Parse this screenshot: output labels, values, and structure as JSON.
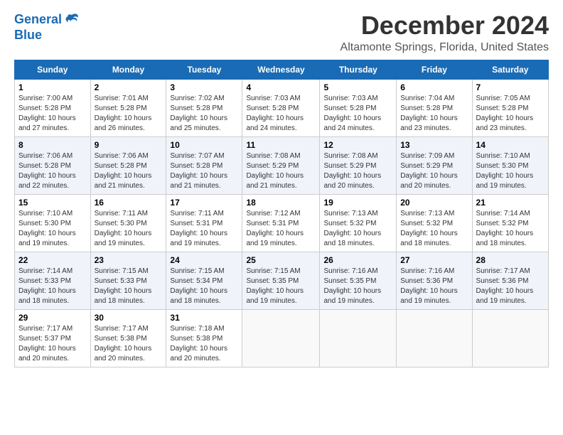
{
  "logo": {
    "line1": "General",
    "line2": "Blue"
  },
  "title": "December 2024",
  "subtitle": "Altamonte Springs, Florida, United States",
  "days_of_week": [
    "Sunday",
    "Monday",
    "Tuesday",
    "Wednesday",
    "Thursday",
    "Friday",
    "Saturday"
  ],
  "weeks": [
    [
      {
        "day": 1,
        "info": "Sunrise: 7:00 AM\nSunset: 5:28 PM\nDaylight: 10 hours\nand 27 minutes."
      },
      {
        "day": 2,
        "info": "Sunrise: 7:01 AM\nSunset: 5:28 PM\nDaylight: 10 hours\nand 26 minutes."
      },
      {
        "day": 3,
        "info": "Sunrise: 7:02 AM\nSunset: 5:28 PM\nDaylight: 10 hours\nand 25 minutes."
      },
      {
        "day": 4,
        "info": "Sunrise: 7:03 AM\nSunset: 5:28 PM\nDaylight: 10 hours\nand 24 minutes."
      },
      {
        "day": 5,
        "info": "Sunrise: 7:03 AM\nSunset: 5:28 PM\nDaylight: 10 hours\nand 24 minutes."
      },
      {
        "day": 6,
        "info": "Sunrise: 7:04 AM\nSunset: 5:28 PM\nDaylight: 10 hours\nand 23 minutes."
      },
      {
        "day": 7,
        "info": "Sunrise: 7:05 AM\nSunset: 5:28 PM\nDaylight: 10 hours\nand 23 minutes."
      }
    ],
    [
      {
        "day": 8,
        "info": "Sunrise: 7:06 AM\nSunset: 5:28 PM\nDaylight: 10 hours\nand 22 minutes."
      },
      {
        "day": 9,
        "info": "Sunrise: 7:06 AM\nSunset: 5:28 PM\nDaylight: 10 hours\nand 21 minutes."
      },
      {
        "day": 10,
        "info": "Sunrise: 7:07 AM\nSunset: 5:28 PM\nDaylight: 10 hours\nand 21 minutes."
      },
      {
        "day": 11,
        "info": "Sunrise: 7:08 AM\nSunset: 5:29 PM\nDaylight: 10 hours\nand 21 minutes."
      },
      {
        "day": 12,
        "info": "Sunrise: 7:08 AM\nSunset: 5:29 PM\nDaylight: 10 hours\nand 20 minutes."
      },
      {
        "day": 13,
        "info": "Sunrise: 7:09 AM\nSunset: 5:29 PM\nDaylight: 10 hours\nand 20 minutes."
      },
      {
        "day": 14,
        "info": "Sunrise: 7:10 AM\nSunset: 5:30 PM\nDaylight: 10 hours\nand 19 minutes."
      }
    ],
    [
      {
        "day": 15,
        "info": "Sunrise: 7:10 AM\nSunset: 5:30 PM\nDaylight: 10 hours\nand 19 minutes."
      },
      {
        "day": 16,
        "info": "Sunrise: 7:11 AM\nSunset: 5:30 PM\nDaylight: 10 hours\nand 19 minutes."
      },
      {
        "day": 17,
        "info": "Sunrise: 7:11 AM\nSunset: 5:31 PM\nDaylight: 10 hours\nand 19 minutes."
      },
      {
        "day": 18,
        "info": "Sunrise: 7:12 AM\nSunset: 5:31 PM\nDaylight: 10 hours\nand 19 minutes."
      },
      {
        "day": 19,
        "info": "Sunrise: 7:13 AM\nSunset: 5:32 PM\nDaylight: 10 hours\nand 18 minutes."
      },
      {
        "day": 20,
        "info": "Sunrise: 7:13 AM\nSunset: 5:32 PM\nDaylight: 10 hours\nand 18 minutes."
      },
      {
        "day": 21,
        "info": "Sunrise: 7:14 AM\nSunset: 5:32 PM\nDaylight: 10 hours\nand 18 minutes."
      }
    ],
    [
      {
        "day": 22,
        "info": "Sunrise: 7:14 AM\nSunset: 5:33 PM\nDaylight: 10 hours\nand 18 minutes."
      },
      {
        "day": 23,
        "info": "Sunrise: 7:15 AM\nSunset: 5:33 PM\nDaylight: 10 hours\nand 18 minutes."
      },
      {
        "day": 24,
        "info": "Sunrise: 7:15 AM\nSunset: 5:34 PM\nDaylight: 10 hours\nand 18 minutes."
      },
      {
        "day": 25,
        "info": "Sunrise: 7:15 AM\nSunset: 5:35 PM\nDaylight: 10 hours\nand 19 minutes."
      },
      {
        "day": 26,
        "info": "Sunrise: 7:16 AM\nSunset: 5:35 PM\nDaylight: 10 hours\nand 19 minutes."
      },
      {
        "day": 27,
        "info": "Sunrise: 7:16 AM\nSunset: 5:36 PM\nDaylight: 10 hours\nand 19 minutes."
      },
      {
        "day": 28,
        "info": "Sunrise: 7:17 AM\nSunset: 5:36 PM\nDaylight: 10 hours\nand 19 minutes."
      }
    ],
    [
      {
        "day": 29,
        "info": "Sunrise: 7:17 AM\nSunset: 5:37 PM\nDaylight: 10 hours\nand 20 minutes."
      },
      {
        "day": 30,
        "info": "Sunrise: 7:17 AM\nSunset: 5:38 PM\nDaylight: 10 hours\nand 20 minutes."
      },
      {
        "day": 31,
        "info": "Sunrise: 7:18 AM\nSunset: 5:38 PM\nDaylight: 10 hours\nand 20 minutes."
      },
      null,
      null,
      null,
      null
    ]
  ]
}
